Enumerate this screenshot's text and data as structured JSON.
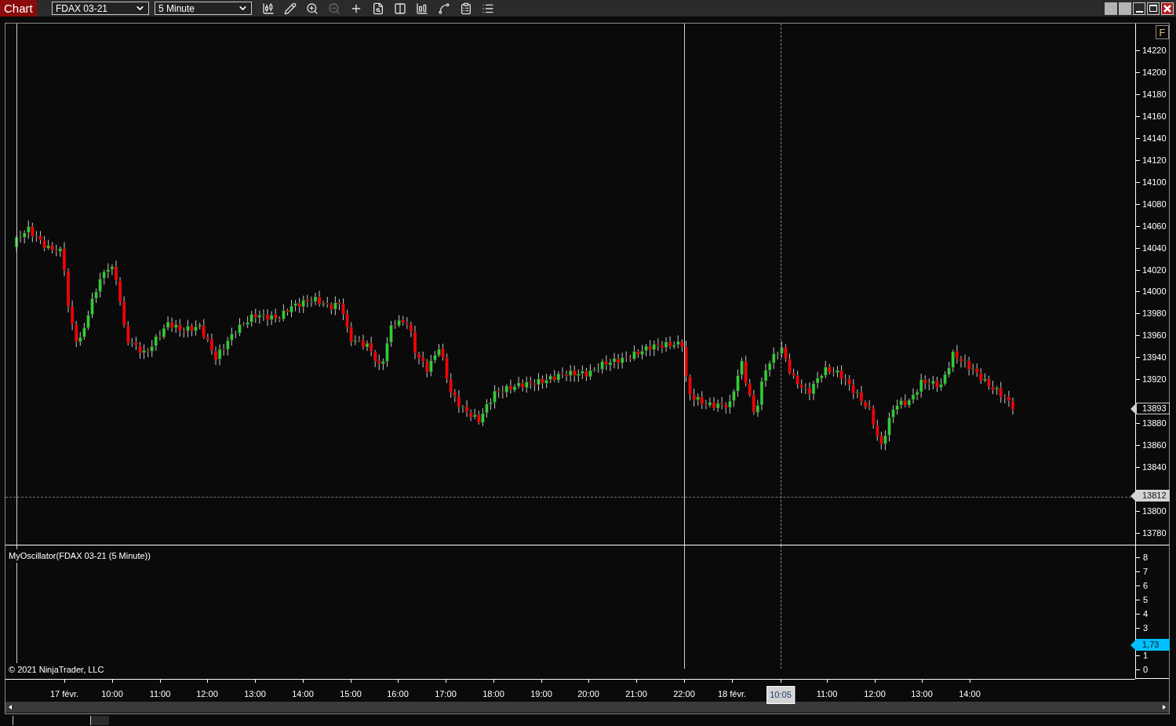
{
  "window": {
    "title": "Chart"
  },
  "instrument": {
    "value": "FDAX 03-21"
  },
  "interval": {
    "value": "5 Minute"
  },
  "toolbar": [
    {
      "kind": "candles",
      "disabled": false
    },
    {
      "kind": "pencil",
      "disabled": false
    },
    {
      "kind": "zoom-in",
      "disabled": false
    },
    {
      "kind": "zoom-out",
      "disabled": true
    },
    {
      "kind": "crosshair",
      "disabled": false
    },
    {
      "kind": "properties",
      "disabled": false
    },
    {
      "kind": "trader",
      "disabled": false
    },
    {
      "kind": "indicators",
      "disabled": false
    },
    {
      "kind": "strategies",
      "disabled": false
    },
    {
      "kind": "templates",
      "disabled": false
    },
    {
      "kind": "list",
      "disabled": false
    }
  ],
  "f_button": "F",
  "price_axis": {
    "labels": [
      "14220",
      "14200",
      "14180",
      "14160",
      "14140",
      "14120",
      "14100",
      "14080",
      "14060",
      "14040",
      "14020",
      "14000",
      "13980",
      "13960",
      "13940",
      "13920",
      "13880",
      "13860",
      "13840",
      "13800",
      "13780"
    ],
    "markers": [
      {
        "value": "13893",
        "kind": "last"
      },
      {
        "value": "13812",
        "kind": "crosshair"
      }
    ]
  },
  "indicator_panel": {
    "label": "MyOscillator(FDAX 03-21 (5 Minute))",
    "axis_labels": [
      "8",
      "7",
      "6",
      "5",
      "4",
      "3",
      "1",
      "0"
    ],
    "marker": "1,73"
  },
  "copyright": "© 2021 NinjaTrader, LLC",
  "time_axis": {
    "labels": [
      {
        "text": "17 févr.",
        "selected": false
      },
      {
        "text": "10:00",
        "selected": false
      },
      {
        "text": "11:00",
        "selected": false
      },
      {
        "text": "12:00",
        "selected": false
      },
      {
        "text": "13:00",
        "selected": false
      },
      {
        "text": "14:00",
        "selected": false
      },
      {
        "text": "15:00",
        "selected": false
      },
      {
        "text": "16:00",
        "selected": false
      },
      {
        "text": "17:00",
        "selected": false
      },
      {
        "text": "18:00",
        "selected": false
      },
      {
        "text": "19:00",
        "selected": false
      },
      {
        "text": "20:00",
        "selected": false
      },
      {
        "text": "21:00",
        "selected": false
      },
      {
        "text": "22:00",
        "selected": false
      },
      {
        "text": "18 févr.",
        "selected": false
      },
      {
        "text": "10:05",
        "selected": true
      },
      {
        "text": "11:00",
        "selected": false
      },
      {
        "text": "12:00",
        "selected": false
      },
      {
        "text": "13:00",
        "selected": false
      },
      {
        "text": "14:00",
        "selected": false
      }
    ]
  }
}
